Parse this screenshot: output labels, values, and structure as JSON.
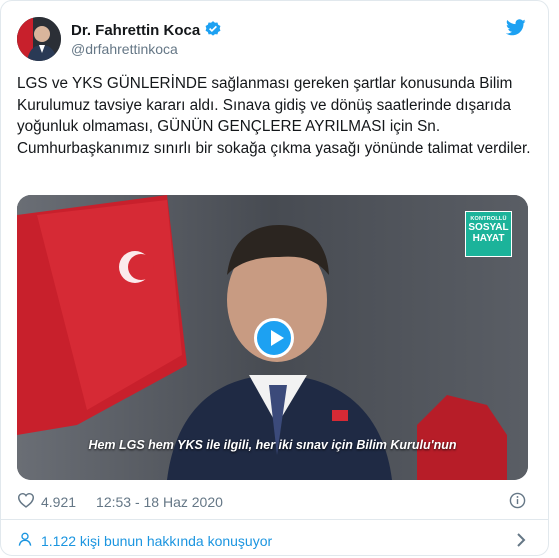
{
  "tweet": {
    "author_name": "Dr. Fahrettin Koca",
    "handle": "@drfahrettinkoca",
    "text": "LGS ve YKS GÜNLERİNDE sağlanması gereken şartlar konusunda Bilim Kurulumuz tavsiye kararı aldı. Sınava gidiş ve dönüş saatlerinde dışarıda yoğunluk olmaması, GÜNÜN GENÇLERE AYRILMASI için Sn. Cumhurbaşkanımız sınırlı bir sokağa çıkma yasağı yönünde talimat verdiler.",
    "likes": "4.921",
    "timestamp": "12:53 - 18 Haz 2020",
    "conversation_link": "1.122 kişi bunun hakkında konuşuyor"
  },
  "video": {
    "badge_line1": "KONTROLLÜ",
    "badge_line2": "SOSYAL",
    "badge_line3": "HAYAT",
    "caption": "Hem LGS hem YKS ile ilgili, her iki sınav için Bilim Kurulu'nun"
  },
  "icons": [
    "verified-icon",
    "twitter-bird-icon",
    "heart-icon",
    "info-icon",
    "user-icon",
    "chevron-right-icon",
    "play-icon"
  ],
  "colors": {
    "accent": "#1da1f2",
    "link": "#1b95e0",
    "muted": "#657786",
    "badge": "#1bb39a"
  }
}
